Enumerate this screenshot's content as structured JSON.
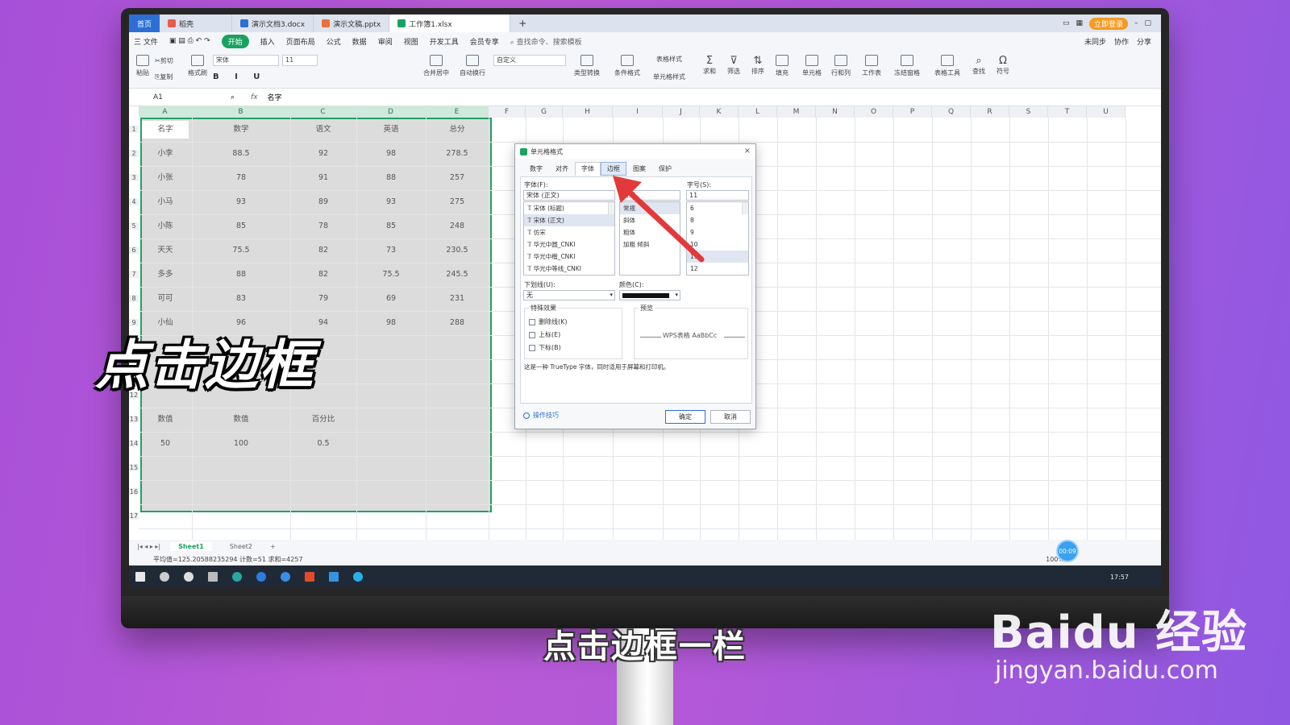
{
  "tabs": {
    "home": "首页",
    "items": [
      {
        "label": "稻壳",
        "color": "#e85d4a"
      },
      {
        "label": "演示文档3.docx",
        "color": "#2b6fd6"
      },
      {
        "label": "演示文稿.pptx",
        "color": "#e8703a"
      },
      {
        "label": "工作簿1.xlsx",
        "color": "#1aa260"
      }
    ],
    "add": "+",
    "vip": "立即登录"
  },
  "menu": {
    "file": "三 文件",
    "items": [
      "开始",
      "插入",
      "页面布局",
      "公式",
      "数据",
      "审阅",
      "视图",
      "开发工具",
      "会员专享"
    ],
    "search": "查找命令、搜索模板",
    "right": [
      "未同步",
      "协作",
      "分享"
    ]
  },
  "ribbon": {
    "paste": "粘贴",
    "cut": "剪切",
    "copy": "复制",
    "format_painter": "格式刷",
    "font": "宋体",
    "size": "11",
    "number_format": "自定义",
    "format_row": "B I U",
    "merge": "合并居中",
    "wrap": "自动换行",
    "convert": "类型转换",
    "cond": "条件格式",
    "table_style": "表格样式",
    "cell_style": "单元格样式",
    "sum": "求和",
    "filter": "筛选",
    "sort": "排序",
    "fill": "填充",
    "cell": "单元格",
    "rowcol": "行和列",
    "sheet": "工作表",
    "freeze": "冻结窗格",
    "tools": "表格工具",
    "find": "查找",
    "symbol": "符号"
  },
  "formula": {
    "name_box": "A1",
    "fx": "fx",
    "value": "名字"
  },
  "columns": [
    "A",
    "B",
    "C",
    "D",
    "E",
    "F",
    "G",
    "H",
    "I",
    "J",
    "K",
    "L",
    "M",
    "N",
    "O",
    "P",
    "Q",
    "R",
    "S",
    "T",
    "U"
  ],
  "rows": [
    "1",
    "2",
    "3",
    "4",
    "5",
    "6",
    "7",
    "8",
    "9",
    "10",
    "11",
    "12",
    "13",
    "14",
    "15",
    "16",
    "17"
  ],
  "table": {
    "headers": [
      "名字",
      "数学",
      "语文",
      "英语",
      "总分"
    ],
    "rows": [
      [
        "小李",
        "88.5",
        "92",
        "98",
        "278.5"
      ],
      [
        "小张",
        "78",
        "91",
        "88",
        "257"
      ],
      [
        "小马",
        "93",
        "89",
        "93",
        "275"
      ],
      [
        "小陈",
        "85",
        "78",
        "85",
        "248"
      ],
      [
        "天天",
        "75.5",
        "82",
        "73",
        "230.5"
      ],
      [
        "多多",
        "88",
        "82",
        "75.5",
        "245.5"
      ],
      [
        "可可",
        "83",
        "79",
        "69",
        "231"
      ],
      [
        "小仙",
        "96",
        "94",
        "98",
        "288"
      ]
    ],
    "row13": [
      "数值",
      "数值",
      "百分比"
    ],
    "row14": [
      "50",
      "100",
      "0.5"
    ]
  },
  "sheets": [
    "Sheet1",
    "Sheet2",
    "+"
  ],
  "status": {
    "stats": "平均值=125.20588235294  计数=51  求和=4257",
    "zoom": "100%"
  },
  "timer": "00:09",
  "clock": "17:57",
  "dialog": {
    "title": "单元格格式",
    "close": "×",
    "tabs": [
      "数字",
      "对齐",
      "字体",
      "边框",
      "图案",
      "保护"
    ],
    "font_label": "字体(F):",
    "font_value": "宋体 (正文)",
    "font_list": [
      "宋体 (标题)",
      "宋体 (正文)",
      "仿宋",
      "华光中圆_CNKI",
      "华光中楷_CNKI",
      "华光中等线_CNKI"
    ],
    "style_value": "常规",
    "style_list": [
      "常规",
      "斜体",
      "粗体",
      "加粗 倾斜"
    ],
    "size_label": "字号(S):",
    "size_value": "11",
    "size_list": [
      "6",
      "8",
      "9",
      "10",
      "11",
      "12"
    ],
    "underline_label": "下划线(U):",
    "underline_value": "无",
    "color_label": "颜色(C):",
    "effects_label": "特殊效果",
    "effects": [
      "删除线(K)",
      "上标(E)",
      "下标(B)"
    ],
    "preview_label": "预览",
    "preview_text": "WPS表格  AaBbCc",
    "note": "这是一种 TrueType 字体，同时适用于屏幕和打印机。",
    "tips": "操作技巧",
    "ok": "确定",
    "cancel": "取消"
  },
  "overlay": {
    "caption": "点击边框",
    "subtitle": "点击边框一栏",
    "watermark_logo": "Baidu 经验",
    "watermark_url": "jingyan.baidu.com"
  },
  "colors": {
    "accent_green": "#1aa260",
    "arrow_red": "#e23a3a",
    "selection_border": "#22a064"
  }
}
